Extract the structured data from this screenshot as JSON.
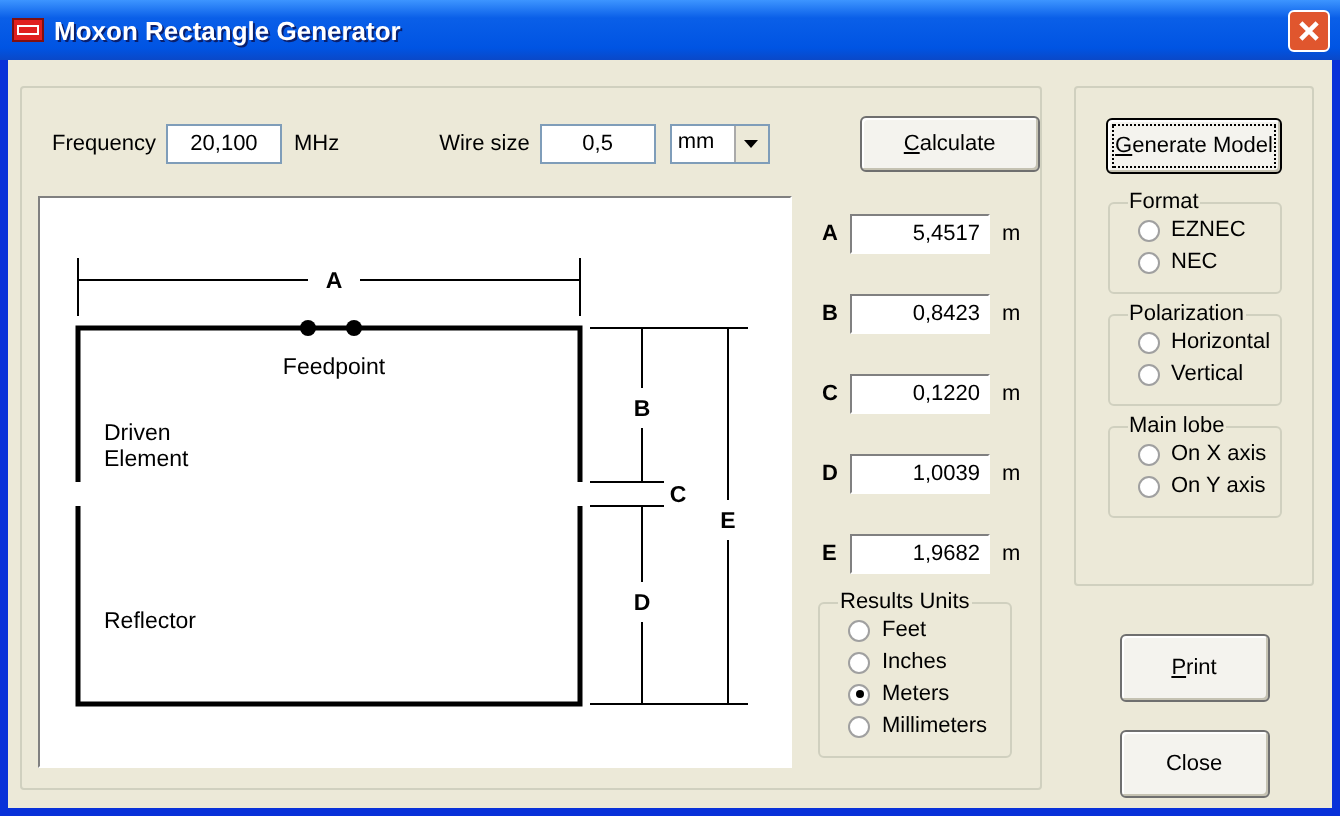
{
  "window": {
    "title": "Moxon Rectangle Generator"
  },
  "frequency": {
    "label": "Frequency",
    "value": "20,100",
    "unit": "MHz"
  },
  "wire_size": {
    "label": "Wire size",
    "value": "0,5",
    "unit_select": "mm"
  },
  "calculate_button": {
    "label": "Calculate",
    "underline_first": true
  },
  "diagram": {
    "dimension_labels": [
      "A",
      "B",
      "C",
      "D",
      "E"
    ],
    "feedpoint": "Feedpoint",
    "driven_element": [
      "Driven",
      "Element"
    ],
    "reflector": "Reflector"
  },
  "results": [
    {
      "label": "A",
      "value": "5,4517",
      "unit": "m"
    },
    {
      "label": "B",
      "value": "0,8423",
      "unit": "m"
    },
    {
      "label": "C",
      "value": "0,1220",
      "unit": "m"
    },
    {
      "label": "D",
      "value": "1,0039",
      "unit": "m"
    },
    {
      "label": "E",
      "value": "1,9682",
      "unit": "m"
    }
  ],
  "results_units": {
    "title": "Results Units",
    "options": [
      {
        "label": "Feet",
        "selected": false
      },
      {
        "label": "Inches",
        "selected": false
      },
      {
        "label": "Meters",
        "selected": true
      },
      {
        "label": "Millimeters",
        "selected": false
      }
    ]
  },
  "generate_button": {
    "label": "Generate Model",
    "underline_first": true
  },
  "option_groups": [
    {
      "title": "Format",
      "options": [
        {
          "label": "EZNEC",
          "selected": false
        },
        {
          "label": "NEC",
          "selected": false
        }
      ]
    },
    {
      "title": "Polarization",
      "options": [
        {
          "label": "Horizontal",
          "selected": false
        },
        {
          "label": "Vertical",
          "selected": false
        }
      ]
    },
    {
      "title": "Main lobe",
      "options": [
        {
          "label": "On X axis",
          "selected": false
        },
        {
          "label": "On Y axis",
          "selected": false
        }
      ]
    }
  ],
  "print_button": {
    "label": "Print",
    "underline_first": true
  },
  "close_button": {
    "label": "Close",
    "underline_first": false
  }
}
